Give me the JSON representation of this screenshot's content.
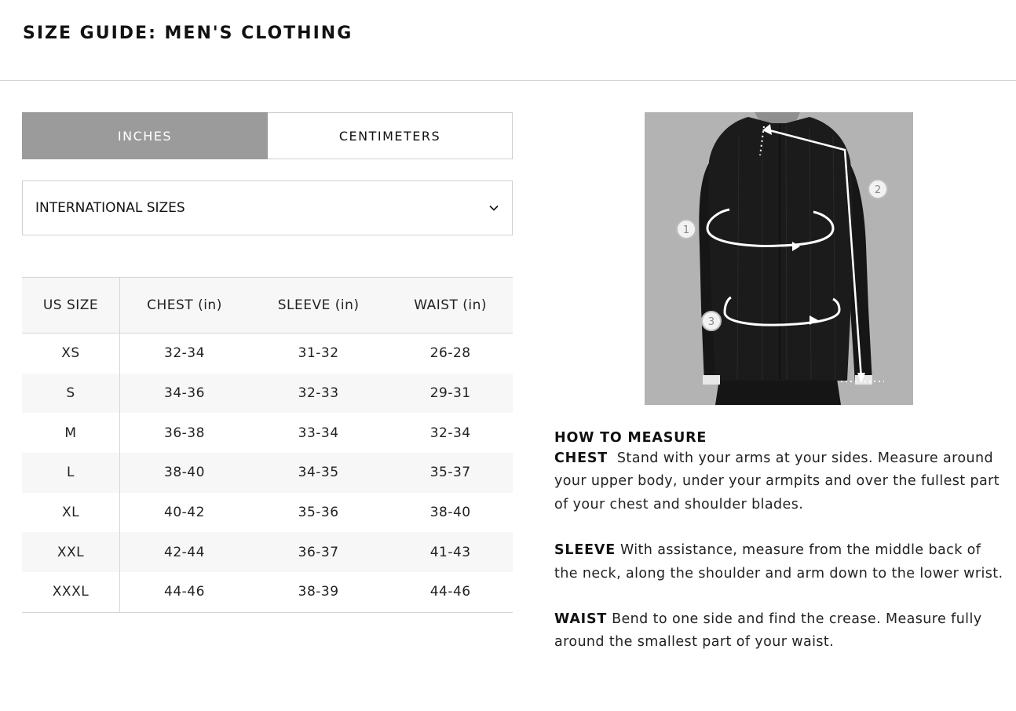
{
  "page": {
    "title": "SIZE GUIDE: MEN'S CLOTHING"
  },
  "units": {
    "inches": "INCHES",
    "centimeters": "CENTIMETERS",
    "selected": "inches"
  },
  "size_system": {
    "selected": "INTERNATIONAL SIZES"
  },
  "table": {
    "headers": [
      "US SIZE",
      "CHEST (in)",
      "SLEEVE (in)",
      "WAIST (in)"
    ],
    "rows": [
      [
        "XS",
        "32-34",
        "31-32",
        "26-28"
      ],
      [
        "S",
        "34-36",
        "32-33",
        "29-31"
      ],
      [
        "M",
        "36-38",
        "33-34",
        "32-34"
      ],
      [
        "L",
        "38-40",
        "34-35",
        "35-37"
      ],
      [
        "XL",
        "40-42",
        "35-36",
        "38-40"
      ],
      [
        "XXL",
        "42-44",
        "36-37",
        "41-43"
      ],
      [
        "XXXL",
        "44-46",
        "38-39",
        "44-46"
      ]
    ]
  },
  "figure": {
    "markers": [
      "1",
      "2",
      "3"
    ]
  },
  "how_to": {
    "heading": "HOW TO MEASURE",
    "items": [
      {
        "term": "CHEST",
        "text": "Stand with your arms at your sides. Measure around your upper body, under your armpits and over the fullest part of your chest and shoulder blades."
      },
      {
        "term": "SLEEVE",
        "text": "With assistance, measure from the middle back of the neck, along the shoulder and arm down to the lower wrist."
      },
      {
        "term": "WAIST",
        "text": "Bend to one side and find the crease. Measure fully around the smallest part of your waist."
      }
    ]
  },
  "colors": {
    "active_toggle": "#9b9b9b",
    "border": "#cfcfcf",
    "row_alt": "#f7f7f7",
    "figure_bg": "#b3b3b3"
  }
}
